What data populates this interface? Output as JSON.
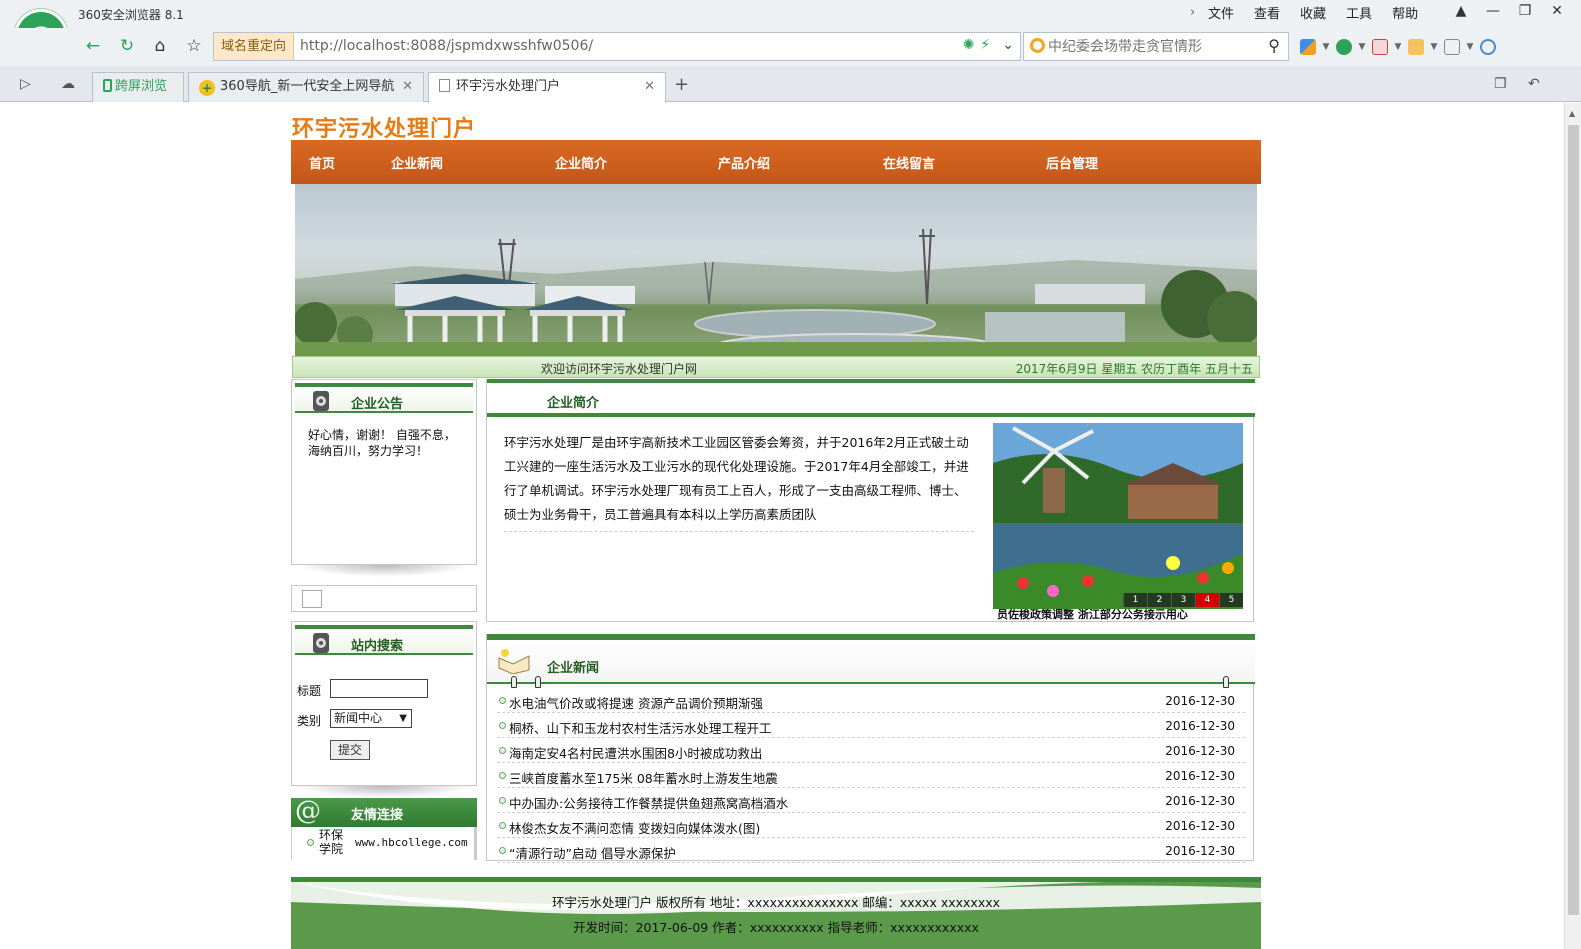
{
  "browser": {
    "app_title": "360安全浏览器 8.1",
    "menu": [
      "文件",
      "查看",
      "收藏",
      "工具",
      "帮助"
    ],
    "redirect_label": "域名重定向",
    "url": "http://localhost:8088/jspmdxwsshfw0506/",
    "search_placeholder": "中纪委会场带走贪官情形",
    "tabs": {
      "split": "跨屏浏览",
      "nav": "360导航_新一代安全上网导航",
      "site": "环宇污水处理门户"
    }
  },
  "site": {
    "title": "环宇污水处理门户",
    "nav": [
      "首页",
      "企业新闻",
      "企业简介",
      "产品介绍",
      "在线留言",
      "后台管理"
    ],
    "welcome": "欢迎访问环宇污水处理门户网",
    "date": "2017年6月9日 星期五 农历丁酉年 五月十五"
  },
  "notice": {
    "title": "企业公告",
    "text": "好心情，谢谢！ 自强不息，海纳百川，努力学习！"
  },
  "search": {
    "title": "站内搜索",
    "title_label": "标题",
    "title_value": "",
    "category_label": "类别",
    "category_value": "新闻中心",
    "submit": "提交"
  },
  "links": {
    "title": "友情连接",
    "items": [
      {
        "name": "环保学院",
        "url": "www.hbcollege.com"
      }
    ]
  },
  "intro": {
    "title": "企业简介",
    "text": "环宇污水处理厂是由环宇高新技术工业园区管委会筹资，并于2016年2月正式破土动工兴建的一座生活污水及工业污水的现代化处理设施。于2017年4月全部竣工，并进行了单机调试。环宇污水处理厂现有员工上百人，形成了一支由高级工程师、博士、硕士为业务骨干，员工普遍具有本科以上学历高素质团队",
    "slides": [
      "1",
      "2",
      "3",
      "4",
      "5"
    ],
    "active_slide": "4",
    "caption": "员佐梭政策调整 浙江部分公务接示用心"
  },
  "news": {
    "title": "企业新闻",
    "items": [
      {
        "title": "水电油气价改或将提速 资源产品调价预期渐强",
        "date": "2016-12-30"
      },
      {
        "title": "桐桥、山下和玉龙村农村生活污水处理工程开工",
        "date": "2016-12-30"
      },
      {
        "title": "海南定安4名村民遭洪水围困8小时被成功救出",
        "date": "2016-12-30"
      },
      {
        "title": "三峡首度蓄水至175米 08年蓄水时上游发生地震",
        "date": "2016-12-30"
      },
      {
        "title": "中办国办:公务接待工作餐禁提供鱼翅燕窝高档酒水",
        "date": "2016-12-30"
      },
      {
        "title": "林俊杰女友不满问恋情 变拨妇向媒体泼水(图)",
        "date": "2016-12-30"
      },
      {
        "title": "“清源行动”启动 倡导水源保护",
        "date": "2016-12-30"
      }
    ]
  },
  "footer": {
    "line1": "环宇污水处理门户 版权所有 地址：xxxxxxxxxxxxxxx 邮编：xxxxx xxxxxxxx",
    "line2": "开发时间：2017-06-09 作者：xxxxxxxxxx 指导老师：xxxxxxxxxxxx"
  }
}
